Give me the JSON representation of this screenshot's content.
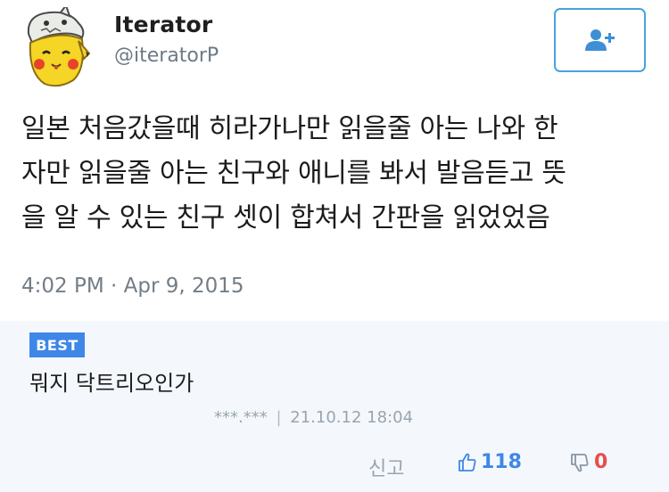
{
  "tweet": {
    "display_name": "Iterator",
    "handle": "@iteratorP",
    "text_lines": [
      "일본 처음갔을때 히라가나만 읽을줄 아는 나와 한",
      "자만 읽을줄 아는 친구와 애니를 봐서 발음듣고 뜻",
      "을 알 수 있는 친구 셋이 합쳐서 간판을 읽었었음"
    ],
    "timestamp": "4:02 PM · Apr 9, 2015",
    "follow_icon": "add-user-icon"
  },
  "comment": {
    "badge": "BEST",
    "text": "뭐지 닥트리오인가",
    "author": "***.***",
    "separator": "|",
    "date": "21.10.12 18:04",
    "report_label": "신고",
    "like_count": "118",
    "dislike_count": "0"
  },
  "colors": {
    "accent_blue": "#3f87e6",
    "follow_border": "#4aa3df",
    "dislike_red": "#e84e4e",
    "comment_bg": "#f4f8fd"
  }
}
